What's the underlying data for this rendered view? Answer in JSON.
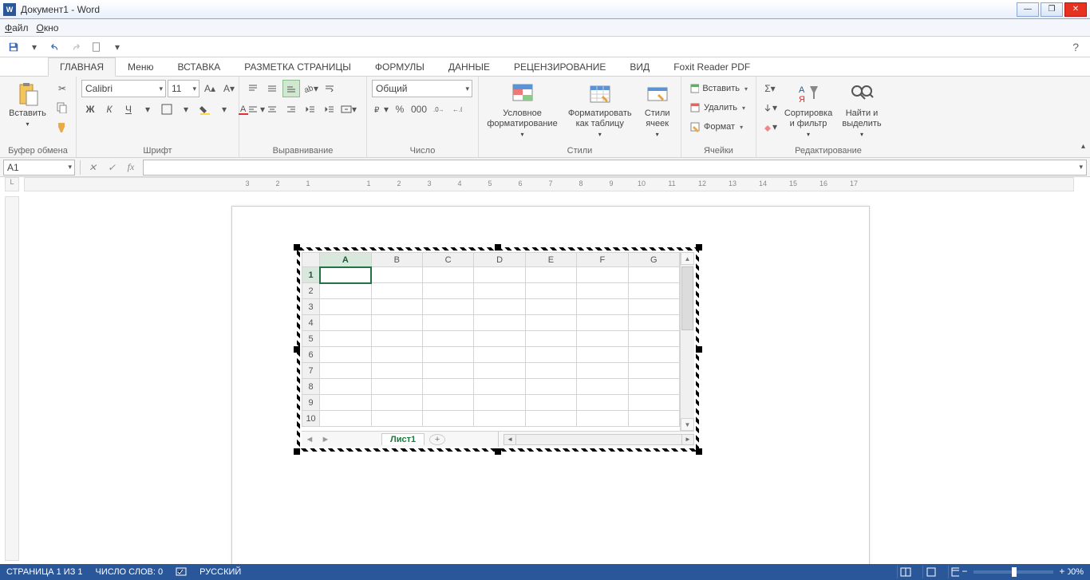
{
  "title": "Документ1 - Word",
  "menu": {
    "file": "Файл",
    "window": "Окно"
  },
  "qat": {
    "help": "?"
  },
  "tabs": [
    "ГЛАВНАЯ",
    "Меню",
    "ВСТАВКА",
    "РАЗМЕТКА СТРАНИЦЫ",
    "ФОРМУЛЫ",
    "ДАННЫЕ",
    "РЕЦЕНЗИРОВАНИЕ",
    "ВИД",
    "Foxit Reader PDF"
  ],
  "activeTab": 0,
  "ribbon": {
    "clipboard": {
      "label": "Буфер обмена",
      "paste": "Вставить"
    },
    "font": {
      "label": "Шрифт",
      "name": "Calibri",
      "size": "11",
      "bold": "Ж",
      "italic": "К",
      "underline": "Ч"
    },
    "alignment": {
      "label": "Выравнивание"
    },
    "number": {
      "label": "Число",
      "format": "Общий",
      "percent": "%",
      "thousands": "000"
    },
    "styles": {
      "label": "Стили",
      "cond": "Условное форматирование",
      "table": "Форматировать как таблицу",
      "cell": "Стили ячеек"
    },
    "cells": {
      "label": "Ячейки",
      "insert": "Вставить",
      "delete": "Удалить",
      "format": "Формат"
    },
    "editing": {
      "label": "Редактирование",
      "sort": "Сортировка и фильтр",
      "find": "Найти и выделить"
    }
  },
  "namebox": "A1",
  "fx": "fx",
  "ruler_numbers": [
    "3",
    "2",
    "1",
    "",
    "1",
    "2",
    "3",
    "4",
    "5",
    "6",
    "7",
    "8",
    "9",
    "10",
    "11",
    "12",
    "13",
    "14",
    "15",
    "16",
    "17"
  ],
  "sheet": {
    "cols": [
      "A",
      "B",
      "C",
      "D",
      "E",
      "F",
      "G"
    ],
    "rows": [
      1,
      2,
      3,
      4,
      5,
      6,
      7,
      8,
      9,
      10
    ],
    "selected": "A1",
    "tab": "Лист1"
  },
  "status": {
    "page": "СТРАНИЦА 1 ИЗ 1",
    "words": "ЧИСЛО СЛОВ: 0",
    "lang": "РУССКИЙ",
    "zoom": "100%"
  }
}
